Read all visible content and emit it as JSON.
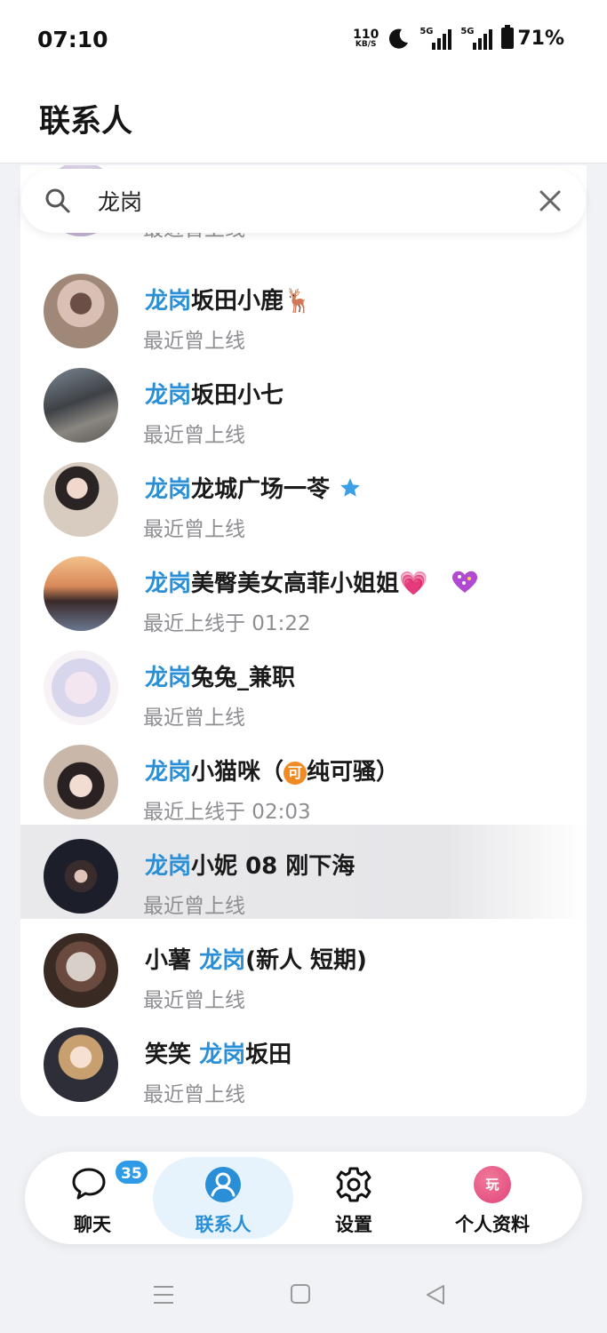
{
  "status_bar": {
    "time": "07:10",
    "net_speed_value": "110",
    "net_speed_unit": "KB/S",
    "signal1_label": "5G",
    "signal2_label": "5G",
    "battery": "71%"
  },
  "header": {
    "title": "联系人"
  },
  "search": {
    "query": "龙岗",
    "placeholder": ""
  },
  "contacts": [
    {
      "highlight": "",
      "name": "",
      "status": "最近曾上线"
    },
    {
      "highlight": "龙岗",
      "name": "坂田小鹿🦌",
      "status": "最近曾上线"
    },
    {
      "highlight": "龙岗",
      "name": "坂田小七",
      "status": "最近曾上线"
    },
    {
      "highlight": "龙岗",
      "name": "龙城广场一苓",
      "status": "最近曾上线"
    },
    {
      "highlight": "龙岗",
      "name": "美臀美女高菲小姐姐💗",
      "status": "最近上线于 01:22"
    },
    {
      "highlight": "龙岗",
      "name": "兔兔_兼职",
      "status": "最近曾上线"
    },
    {
      "highlight": "龙岗",
      "name_prefix": "小猫咪（",
      "badge": "可",
      "name_suffix": "纯可骚）",
      "status": "最近上线于 02:03"
    },
    {
      "highlight": "龙岗",
      "name": "小妮 08 刚下海",
      "status": "最近曾上线"
    },
    {
      "prefix": "小薯 ",
      "highlight": "龙岗",
      "name": "(新人 短期)",
      "status": "最近曾上线"
    },
    {
      "prefix": "笑笑 ",
      "highlight": "龙岗",
      "name": "坂田",
      "status": "最近曾上线"
    }
  ],
  "tabs": {
    "chat": {
      "label": "聊天",
      "badge": "35"
    },
    "contacts": {
      "label": "联系人"
    },
    "settings": {
      "label": "设置"
    },
    "profile": {
      "label": "个人资料",
      "avatar_text": "玩"
    }
  },
  "colors": {
    "accent": "#2a8fd6",
    "badge": "#2f9be6"
  }
}
